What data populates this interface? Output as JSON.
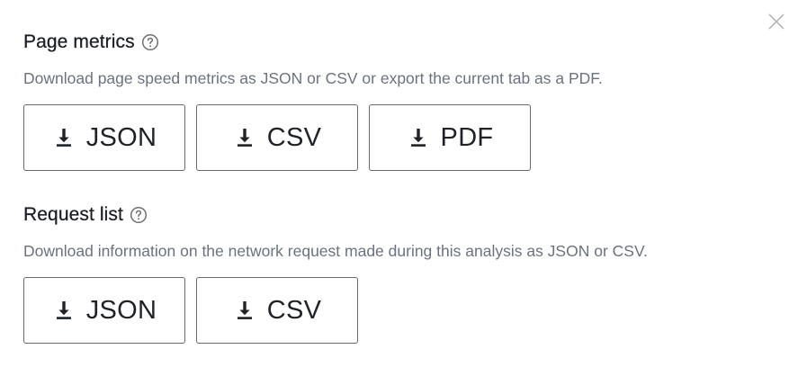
{
  "close": {
    "icon": "close-icon"
  },
  "page_metrics": {
    "title": "Page metrics",
    "help_icon": "help-circle-icon",
    "description": "Download page speed metrics as JSON or CSV or export the current tab as a PDF.",
    "buttons": [
      {
        "label": "JSON",
        "icon": "download-icon"
      },
      {
        "label": "CSV",
        "icon": "download-icon"
      },
      {
        "label": "PDF",
        "icon": "download-icon"
      }
    ]
  },
  "request_list": {
    "title": "Request list",
    "help_icon": "help-circle-icon",
    "description": "Download information on the network request made during this analysis as JSON or CSV.",
    "buttons": [
      {
        "label": "JSON",
        "icon": "download-icon"
      },
      {
        "label": "CSV",
        "icon": "download-icon"
      }
    ]
  },
  "colors": {
    "text": "#1f2328",
    "muted": "#6b7280",
    "border": "#6b6b6b"
  }
}
